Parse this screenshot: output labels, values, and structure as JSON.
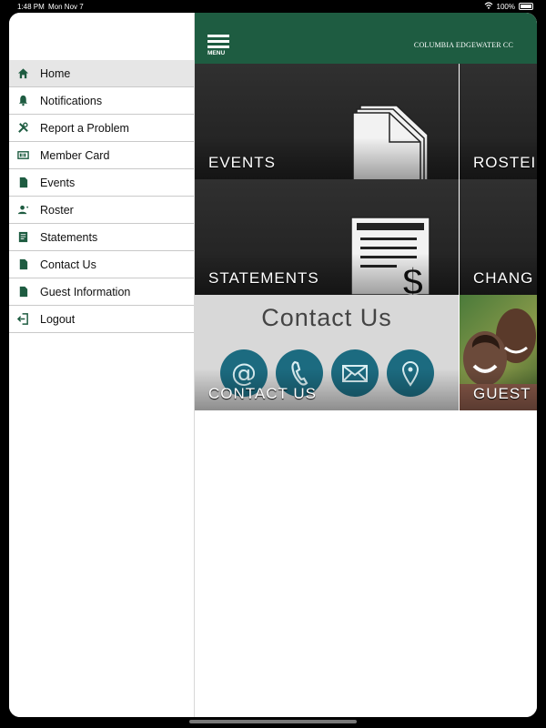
{
  "status_bar": {
    "time": "1:48 PM",
    "date": "Mon Nov 7",
    "battery": "100%"
  },
  "drawer": {
    "items": [
      {
        "label": "Home",
        "icon": "home-icon",
        "active": true
      },
      {
        "label": "Notifications",
        "icon": "bell-icon",
        "active": false
      },
      {
        "label": "Report a Problem",
        "icon": "tools-icon",
        "active": false
      },
      {
        "label": "Member Card",
        "icon": "card-icon",
        "active": false
      },
      {
        "label": "Events",
        "icon": "document-icon",
        "active": false
      },
      {
        "label": "Roster",
        "icon": "people-icon",
        "active": false
      },
      {
        "label": "Statements",
        "icon": "statement-icon",
        "active": false
      },
      {
        "label": "Contact Us",
        "icon": "document-icon",
        "active": false
      },
      {
        "label": "Guest Information",
        "icon": "document-icon",
        "active": false
      },
      {
        "label": "Logout",
        "icon": "logout-icon",
        "active": false
      }
    ]
  },
  "header": {
    "menu_label": "MENU",
    "club_name": "COLUMBIA EDGEWATER CC"
  },
  "tiles": {
    "events": "EVENTS",
    "roster": "ROSTEI",
    "statements": "STATEMENTS",
    "change": "CHANG",
    "contact": "CONTACT US",
    "contact_heading": "Contact Us",
    "guest": "GUEST"
  },
  "colors": {
    "brand_green": "#1e5c41",
    "contact_teal": "#1c6b80"
  }
}
